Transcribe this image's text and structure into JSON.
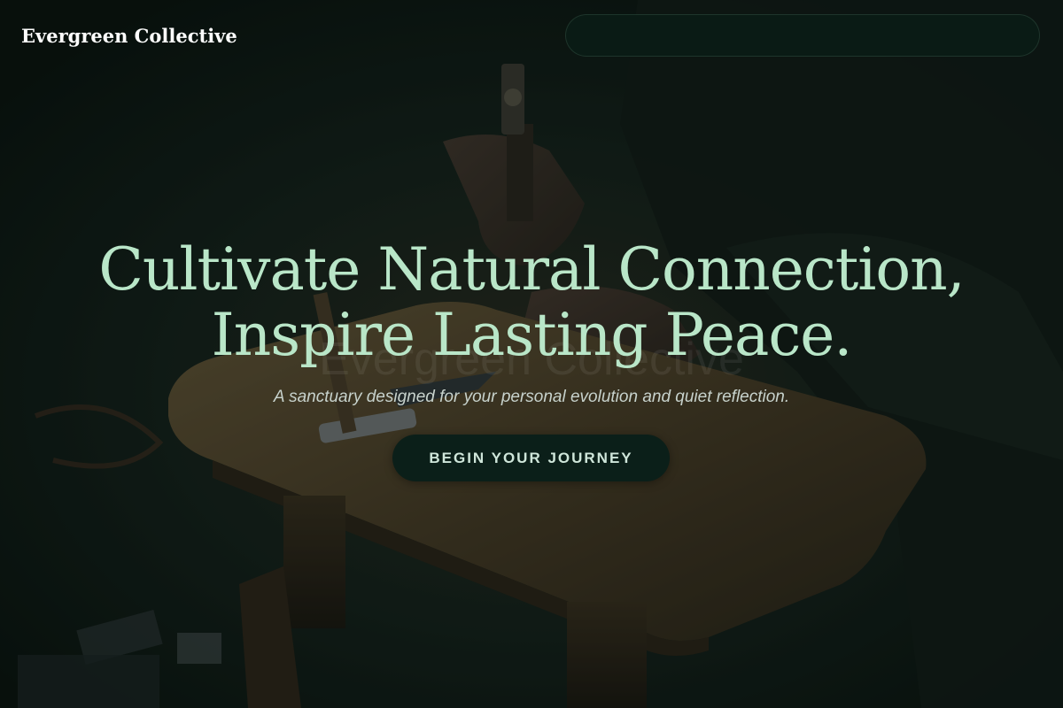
{
  "header": {
    "brand": "Evergreen Collective"
  },
  "hero": {
    "title_line1": "Cultivate Natural Connection,",
    "title_line2": "Inspire Lasting Peace.",
    "ghost_text": "Evergreen Collective",
    "subtitle": "A sanctuary designed for your personal evolution and quiet reflection.",
    "cta_label": "BEGIN YOUR JOURNEY"
  },
  "colors": {
    "accent_title": "#b9e6c8",
    "button_bg": "#0b1f19",
    "overlay": "#08120e"
  },
  "background": {
    "image_description_icon": "craftsman-workbench-photo"
  }
}
